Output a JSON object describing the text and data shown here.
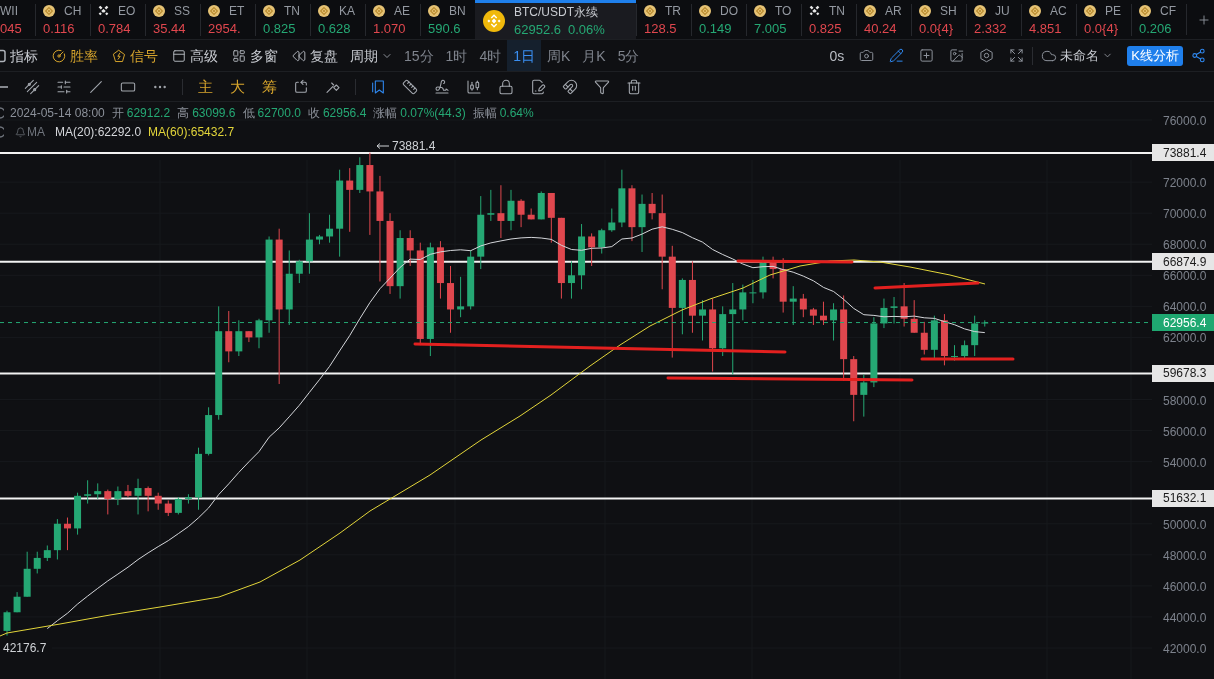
{
  "ticker": {
    "items": [
      {
        "symbol": "WII",
        "price": "045",
        "rising": false,
        "kind": "plain",
        "selected": false
      },
      {
        "symbol": "CH",
        "price": "0.116",
        "rising": false,
        "kind": "coin",
        "selected": false
      },
      {
        "symbol": "EO",
        "price": "0.784",
        "rising": false,
        "kind": "cross",
        "selected": false
      },
      {
        "symbol": "SS",
        "price": "35.44",
        "rising": false,
        "kind": "coin",
        "selected": false
      },
      {
        "symbol": "ET",
        "price": "2954.",
        "rising": false,
        "kind": "coin",
        "selected": false
      },
      {
        "symbol": "TN",
        "price": "0.825",
        "rising": true,
        "kind": "coin",
        "selected": false
      },
      {
        "symbol": "KA",
        "price": "0.628",
        "rising": true,
        "kind": "coin",
        "selected": false
      },
      {
        "symbol": "AE",
        "price": "1.070",
        "rising": false,
        "kind": "coin",
        "selected": false
      },
      {
        "symbol": "BN",
        "price": "590.6",
        "rising": true,
        "kind": "coin",
        "selected": false
      },
      {
        "symbol": "BTC/USDT永续",
        "price": "62952.6",
        "change": "0.06%",
        "rising": true,
        "kind": "coin",
        "selected": true
      },
      {
        "symbol": "TR",
        "price": "128.5",
        "rising": false,
        "kind": "coin",
        "selected": false
      },
      {
        "symbol": "DO",
        "price": "0.149",
        "rising": true,
        "kind": "coin",
        "selected": false
      },
      {
        "symbol": "TO",
        "price": "7.005",
        "rising": true,
        "kind": "coin",
        "selected": false
      },
      {
        "symbol": "TN",
        "price": "0.825",
        "rising": false,
        "kind": "cross",
        "selected": false
      },
      {
        "symbol": "AR",
        "price": "40.24",
        "rising": false,
        "kind": "coin",
        "selected": false
      },
      {
        "symbol": "SH",
        "price": "0.0{4}",
        "rising": false,
        "kind": "coin",
        "selected": false
      },
      {
        "symbol": "JU",
        "price": "2.332",
        "rising": false,
        "kind": "coin",
        "selected": false
      },
      {
        "symbol": "AC",
        "price": "4.851",
        "rising": false,
        "kind": "coin",
        "selected": false
      },
      {
        "symbol": "PE",
        "price": "0.0{4}",
        "rising": false,
        "kind": "coin",
        "selected": false
      },
      {
        "symbol": "CF",
        "price": "0.206",
        "rising": true,
        "kind": "coin",
        "selected": false
      }
    ]
  },
  "toolbar": {
    "menus": [
      {
        "label": "指标",
        "accent": false
      },
      {
        "label": "胜率",
        "accent": true
      },
      {
        "label": "信号",
        "accent": true
      },
      {
        "label": "高级",
        "accent": false
      },
      {
        "label": "多窗",
        "accent": false
      },
      {
        "label": "复盘",
        "accent": false
      }
    ],
    "period": {
      "label": "周期",
      "options": [
        {
          "label": "15分",
          "selected": false
        },
        {
          "label": "1时",
          "selected": false
        },
        {
          "label": "4时",
          "selected": false
        },
        {
          "label": "1日",
          "selected": true
        },
        {
          "label": "周K",
          "selected": false
        },
        {
          "label": "月K",
          "selected": false
        },
        {
          "label": "5分",
          "selected": false
        }
      ]
    },
    "timer": "0s",
    "tools": [
      {
        "active": false
      },
      {
        "active": true
      },
      {
        "active": false
      },
      {
        "active": false
      },
      {
        "active": false
      },
      {
        "active": false
      }
    ],
    "layout": {
      "label": "未命名"
    },
    "analysis_button": "K线分析"
  },
  "drawing_toolbar": {
    "groups": [
      {
        "items": [
          {
            "kind": "icon",
            "active": false
          },
          {
            "kind": "icon",
            "active": false
          },
          {
            "kind": "icon",
            "active": false
          },
          {
            "kind": "icon",
            "active": false
          },
          {
            "kind": "icon",
            "active": false
          },
          {
            "kind": "icon",
            "active": false
          }
        ]
      },
      {
        "items": [
          {
            "kind": "text",
            "label": "主"
          },
          {
            "kind": "text",
            "label": "大"
          },
          {
            "kind": "text",
            "label": "筹"
          },
          {
            "kind": "icon",
            "active": false
          },
          {
            "kind": "icon",
            "active": false
          }
        ]
      },
      {
        "items": [
          {
            "kind": "icon",
            "active": true
          },
          {
            "kind": "icon",
            "active": false
          },
          {
            "kind": "icon",
            "active": false
          },
          {
            "kind": "icon",
            "active": false
          },
          {
            "kind": "icon",
            "active": false
          },
          {
            "kind": "icon",
            "active": false
          },
          {
            "kind": "icon",
            "active": false
          },
          {
            "kind": "icon",
            "active": false
          },
          {
            "kind": "icon",
            "active": false
          }
        ]
      }
    ]
  },
  "chart": {
    "legend": {
      "datetime": "2024-05-14 08:00",
      "rising": true,
      "fields": [
        {
          "label": "开",
          "value": "62912.2"
        },
        {
          "label": "高",
          "value": "63099.6"
        },
        {
          "label": "低",
          "value": "62700.0"
        },
        {
          "label": "收",
          "value": "62956.4"
        },
        {
          "label": "涨幅",
          "value": "0.07%(44.3)"
        },
        {
          "label": "振幅",
          "value": "0.64%"
        }
      ]
    },
    "indicator": {
      "label": "MA",
      "lines": [
        {
          "text": "MA(20):62292.0",
          "color": "#d4d6da"
        },
        {
          "text": "MA(60):65432.7",
          "color": "#e2d53a"
        }
      ]
    },
    "high_marker": "73881.4",
    "low_marker": "42176.7",
    "price_lines": [
      "73881.4",
      "66874.9",
      "59678.3",
      "51632.1"
    ],
    "current_price": "62956.4",
    "axis_labels": [
      "76000.0",
      "72000.0",
      "70000.0",
      "68000.0",
      "66000.0",
      "64000.0",
      "62000.0",
      "58000.0",
      "56000.0",
      "54000.0",
      "50000.0",
      "48000.0",
      "46000.0",
      "44000.0",
      "42000.0"
    ]
  }
}
